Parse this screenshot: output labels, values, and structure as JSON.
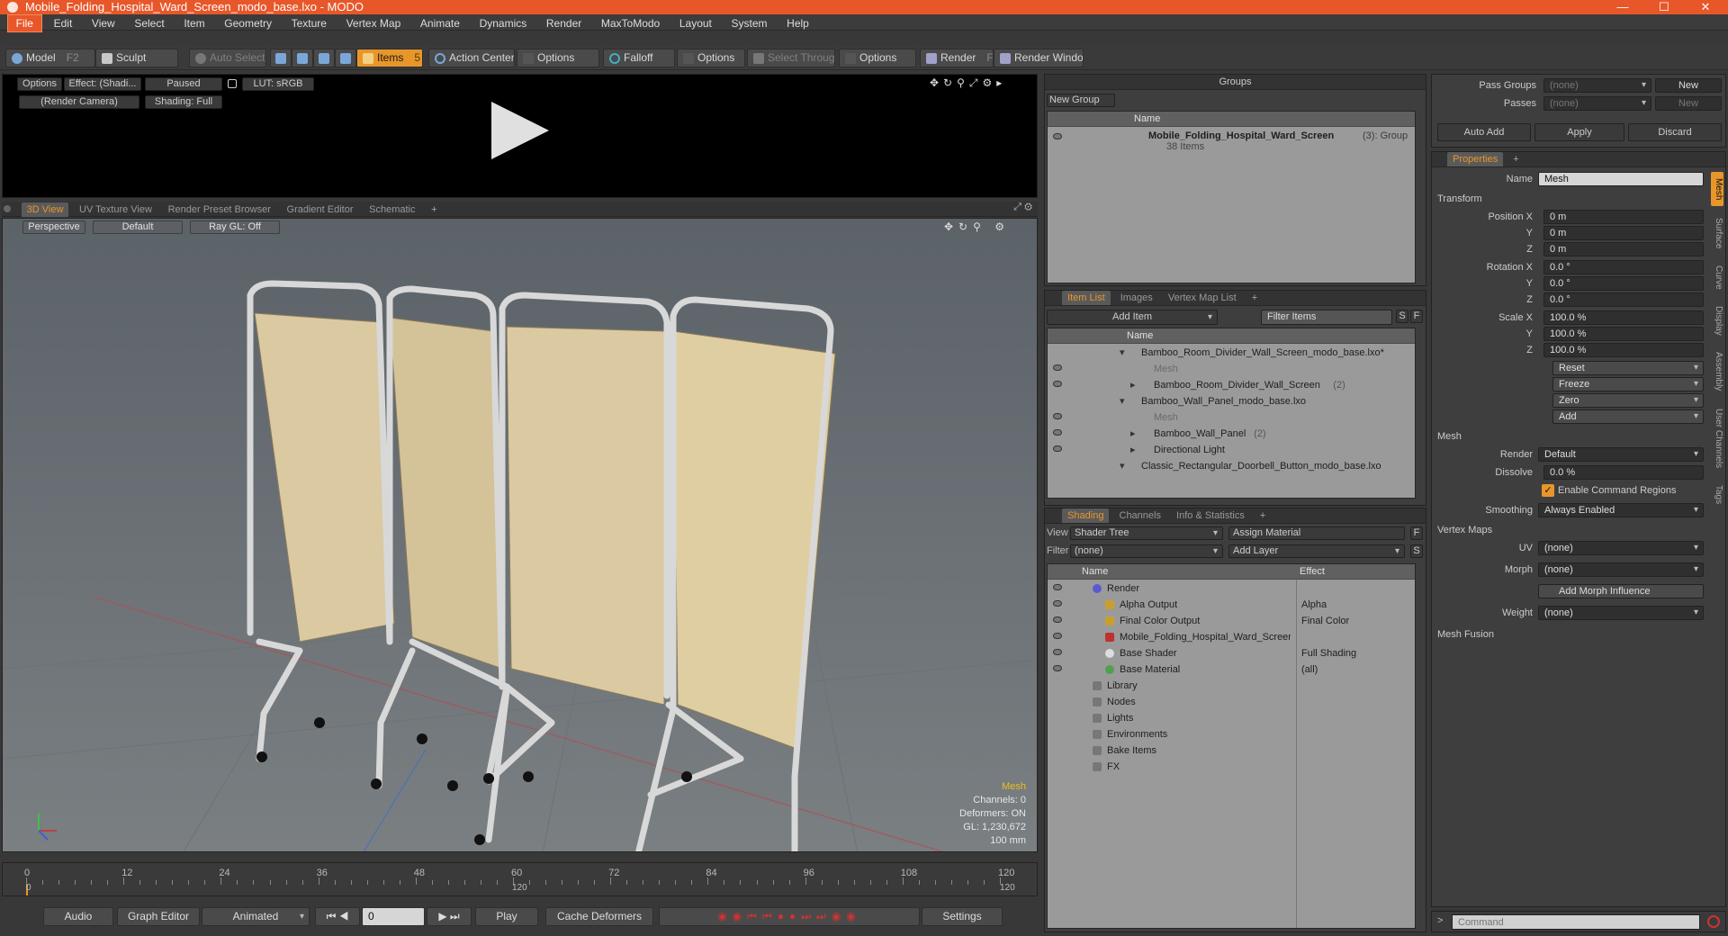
{
  "window": {
    "title": "Mobile_Folding_Hospital_Ward_Screen_modo_base.lxo - MODO"
  },
  "menu": [
    "File",
    "Edit",
    "View",
    "Select",
    "Item",
    "Geometry",
    "Texture",
    "Vertex Map",
    "Animate",
    "Dynamics",
    "Render",
    "MaxToModo",
    "Layout",
    "System",
    "Help"
  ],
  "toolbar": {
    "model": "Model",
    "model_key": "F2",
    "sculpt": "Sculpt",
    "auto_select": "Auto Select",
    "items": "Items",
    "items_key": "5",
    "action_center": "Action Center",
    "options1": "Options",
    "falloff": "Falloff",
    "options2": "Options",
    "select_through": "Select Through",
    "options3": "Options",
    "render": "Render",
    "render_key": "F9",
    "render_window": "Render Window"
  },
  "render_preview": {
    "options": "Options",
    "effect": "Effect: (Shadi...",
    "paused": "Paused",
    "lut": "LUT: sRGB",
    "camera": "(Render Camera)",
    "shading": "Shading: Full"
  },
  "view_tabs": [
    "3D View",
    "UV Texture View",
    "Render Preset Browser",
    "Gradient Editor",
    "Schematic",
    "+"
  ],
  "viewport": {
    "perspective": "Perspective",
    "default": "Default",
    "raygl": "Ray GL: Off",
    "info_mesh": "Mesh",
    "channels": "Channels: 0",
    "deformers": "Deformers: ON",
    "gl": "GL: 1,230,672",
    "units": "100 mm"
  },
  "timeline": {
    "ticks": [
      "0",
      "12",
      "24",
      "36",
      "48",
      "60",
      "72",
      "84",
      "96",
      "108",
      "120"
    ],
    "sub_start": "0",
    "sub_mid": "120",
    "sub_end": "120"
  },
  "bottombar": {
    "audio": "Audio",
    "graph_editor": "Graph Editor",
    "animated": "Animated",
    "frame": "0",
    "play": "Play",
    "cache": "Cache Deformers",
    "settings": "Settings"
  },
  "groups": {
    "title": "Groups",
    "new_group": "New Group",
    "col_name": "Name",
    "item_name": "Mobile_Folding_Hospital_Ward_Screen",
    "item_count": "(3)",
    "item_type": ": Group",
    "item_sub": "38 Items"
  },
  "item_list": {
    "tabs": [
      "Item List",
      "Images",
      "Vertex Map List",
      "+"
    ],
    "add_item": "Add Item",
    "filter": "Filter Items",
    "s": "S",
    "f": "F",
    "col_name": "Name",
    "rows": [
      {
        "text": "Bamboo_Room_Divider_Wall_Screen_modo_base.lxo*",
        "indent": 0,
        "dim": false,
        "count": ""
      },
      {
        "text": "Mesh",
        "indent": 1,
        "dim": true,
        "count": ""
      },
      {
        "text": "Bamboo_Room_Divider_Wall_Screen",
        "indent": 1,
        "dim": false,
        "count": "(2)"
      },
      {
        "text": "Bamboo_Wall_Panel_modo_base.lxo",
        "indent": 0,
        "dim": false,
        "count": ""
      },
      {
        "text": "Mesh",
        "indent": 1,
        "dim": true,
        "count": ""
      },
      {
        "text": "Bamboo_Wall_Panel",
        "indent": 1,
        "dim": false,
        "count": "(2)"
      },
      {
        "text": "Directional Light",
        "indent": 1,
        "dim": false,
        "count": ""
      },
      {
        "text": "Classic_Rectangular_Doorbell_Button_modo_base.lxo",
        "indent": 0,
        "dim": false,
        "count": ""
      }
    ]
  },
  "shading": {
    "tabs": [
      "Shading",
      "Channels",
      "Info & Statistics",
      "+"
    ],
    "view_label": "View",
    "view_value": "Shader Tree",
    "assign": "Assign Material",
    "f": "F",
    "filter_label": "Filter",
    "filter_value": "(none)",
    "add_layer": "Add Layer",
    "s": "S",
    "col_name": "Name",
    "col_effect": "Effect",
    "rows": [
      {
        "name": "Render",
        "effect": "",
        "indent": 0
      },
      {
        "name": "Alpha Output",
        "effect": "Alpha",
        "indent": 1
      },
      {
        "name": "Final Color Output",
        "effect": "Final Color",
        "indent": 1
      },
      {
        "name": "Mobile_Folding_Hospital_Ward_Screen",
        "effect": "",
        "indent": 1
      },
      {
        "name": "Base Shader",
        "effect": "Full Shading",
        "indent": 1
      },
      {
        "name": "Base Material",
        "effect": "(all)",
        "indent": 1
      },
      {
        "name": "Library",
        "effect": "",
        "indent": 0
      },
      {
        "name": "Nodes",
        "effect": "",
        "indent": 0
      },
      {
        "name": "Lights",
        "effect": "",
        "indent": 0
      },
      {
        "name": "Environments",
        "effect": "",
        "indent": 0
      },
      {
        "name": "Bake Items",
        "effect": "",
        "indent": 0
      },
      {
        "name": "FX",
        "effect": "",
        "indent": 0
      }
    ]
  },
  "pass": {
    "pass_groups": "Pass Groups",
    "passes": "Passes",
    "none1": "(none)",
    "none2": "(none)",
    "new1": "New",
    "new2": "New",
    "auto_add": "Auto Add",
    "apply": "Apply",
    "discard": "Discard"
  },
  "properties": {
    "title": "Properties",
    "plus": "+",
    "name_label": "Name",
    "name_value": "Mesh",
    "transform": "Transform",
    "position_x_label": "Position X",
    "pos_x": "0 m",
    "pos_y": "0 m",
    "pos_z": "0 m",
    "rotation_x_label": "Rotation X",
    "rot_x": "0.0 °",
    "rot_y": "0.0 °",
    "rot_z": "0.0 °",
    "scale_x_label": "Scale X",
    "scl_x": "100.0 %",
    "scl_y": "100.0 %",
    "scl_z": "100.0 %",
    "y": "Y",
    "z": "Z",
    "reset": "Reset",
    "freeze": "Freeze",
    "zero": "Zero",
    "add": "Add",
    "mesh": "Mesh",
    "render_label": "Render",
    "render_value": "Default",
    "dissolve_label": "Dissolve",
    "dissolve_value": "0.0 %",
    "enable_cmd": "Enable Command Regions",
    "smoothing_label": "Smoothing",
    "smoothing_value": "Always Enabled",
    "vertex_maps": "Vertex Maps",
    "uv_label": "UV",
    "uv_value": "(none)",
    "morph_label": "Morph",
    "morph_value": "(none)",
    "add_morph": "Add Morph Influence",
    "weight_label": "Weight",
    "weight_value": "(none)",
    "mesh_fusion": "Mesh Fusion",
    "side_tabs": [
      "Mesh",
      "Surface",
      "Curve",
      "Display",
      "Assembly",
      "User Channels",
      "Tags"
    ],
    "command_placeholder": "Command"
  },
  "colors": {
    "accent": "#e8572a",
    "highlight": "#e8962a"
  }
}
